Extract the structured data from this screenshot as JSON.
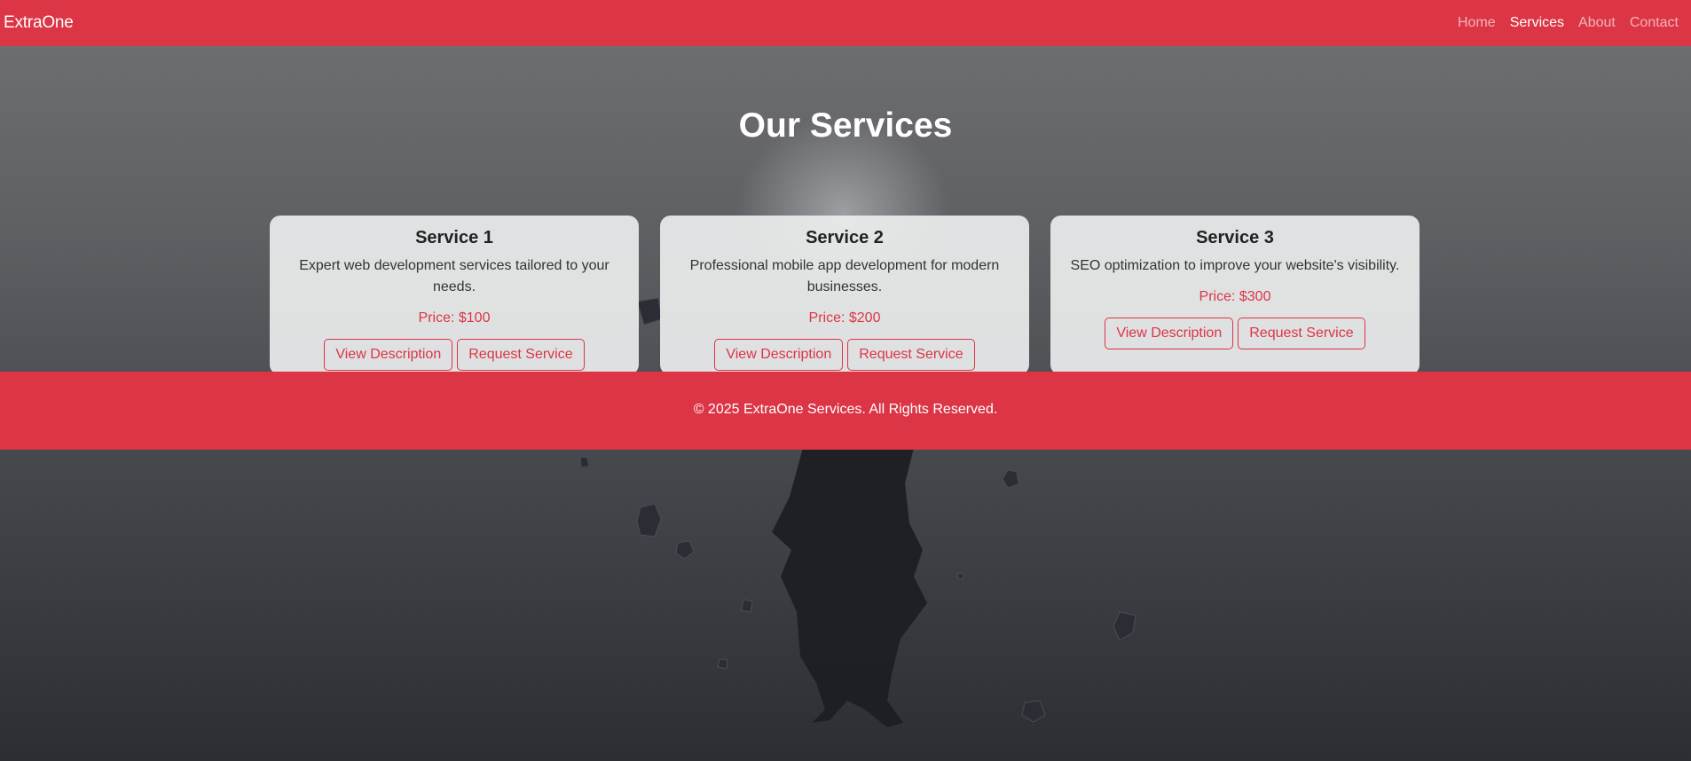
{
  "navbar": {
    "brand": "ExtraOne",
    "links": [
      {
        "label": "Home",
        "active": false
      },
      {
        "label": "Services",
        "active": true
      },
      {
        "label": "About",
        "active": false
      },
      {
        "label": "Contact",
        "active": false
      }
    ]
  },
  "page": {
    "heading": "Our Services"
  },
  "services": [
    {
      "title": "Service 1",
      "description": "Expert web development services tailored to your needs.",
      "price": "Price: $100",
      "view_label": "View Description",
      "request_label": "Request Service"
    },
    {
      "title": "Service 2",
      "description": "Professional mobile app development for modern businesses.",
      "price": "Price: $200",
      "view_label": "View Description",
      "request_label": "Request Service"
    },
    {
      "title": "Service 3",
      "description": "SEO optimization to improve your website's visibility.",
      "price": "Price: $300",
      "view_label": "View Description",
      "request_label": "Request Service"
    }
  ],
  "footer": {
    "text": "© 2025 ExtraOne Services. All Rights Reserved."
  },
  "colors": {
    "accent": "#dc3545",
    "card_bg": "#ecedeD",
    "background_top": "#707175",
    "background_bottom": "#2b2e33"
  },
  "icons": {
    "background_art": "silhouette-figure-with-floating-rocks"
  }
}
